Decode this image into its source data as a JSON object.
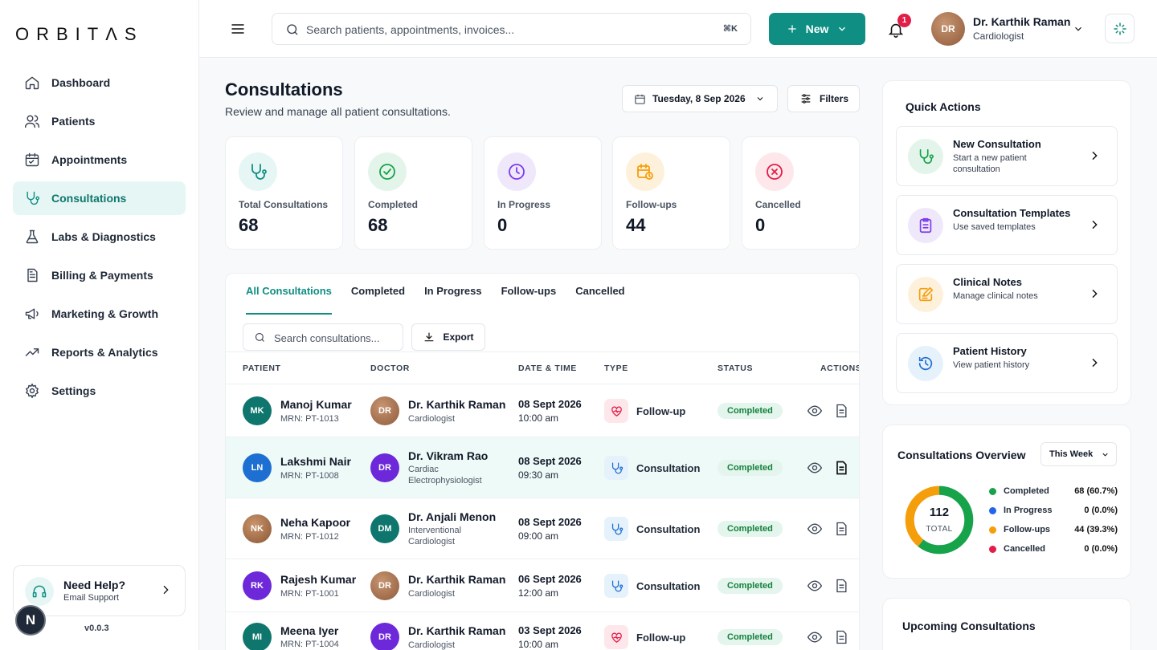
{
  "app": {
    "logo": "ORBITΛS",
    "version": "v0.0.3",
    "bottom_badge": "N"
  },
  "nav": [
    {
      "label": "Dashboard",
      "icon": "home-icon"
    },
    {
      "label": "Patients",
      "icon": "users-icon"
    },
    {
      "label": "Appointments",
      "icon": "calendar-icon"
    },
    {
      "label": "Consultations",
      "icon": "stethoscope-icon",
      "active": true
    },
    {
      "label": "Labs & Diagnostics",
      "icon": "flask-icon"
    },
    {
      "label": "Billing & Payments",
      "icon": "receipt-icon"
    },
    {
      "label": "Marketing & Growth",
      "icon": "megaphone-icon"
    },
    {
      "label": "Reports & Analytics",
      "icon": "trend-icon"
    },
    {
      "label": "Settings",
      "icon": "gear-icon"
    }
  ],
  "help": {
    "title": "Need Help?",
    "subtitle": "Email Support"
  },
  "header": {
    "search_placeholder": "Search patients, appointments, invoices...",
    "shortcut": "⌘K",
    "new_label": "New",
    "notifications": "1",
    "user": {
      "initials": "DR",
      "name": "Dr. Karthik Raman",
      "role": "Cardiologist"
    }
  },
  "page": {
    "title": "Consultations",
    "subtitle": "Review and manage all patient consultations.",
    "date": "Tuesday, 8 Sep 2026",
    "filters_label": "Filters"
  },
  "stats": [
    {
      "label": "Total Consultations",
      "value": "68",
      "color": "#0f8f83"
    },
    {
      "label": "Completed",
      "value": "68",
      "color": "#16a34a"
    },
    {
      "label": "In Progress",
      "value": "0",
      "color": "#7c3aed"
    },
    {
      "label": "Follow-ups",
      "value": "44",
      "color": "#f59e0b"
    },
    {
      "label": "Cancelled",
      "value": "0",
      "color": "#e11d48"
    }
  ],
  "table": {
    "tabs": [
      "All Consultations",
      "Completed",
      "In Progress",
      "Follow-ups",
      "Cancelled"
    ],
    "search_placeholder": "Search consultations...",
    "export_label": "Export",
    "headers": [
      "PATIENT",
      "DOCTOR",
      "DATE & TIME",
      "TYPE",
      "STATUS",
      "ACTIONS"
    ],
    "rows": [
      {
        "initials": "MK",
        "patient": "Manoj Kumar",
        "mrn": "MRN: PT-1013",
        "doc_initials": "DR",
        "doctor": "Dr. Karthik Raman",
        "specialty": "Cardiologist",
        "date": "08 Sept 2026",
        "time": "10:00 am",
        "type": "Follow-up",
        "status": "Completed"
      },
      {
        "initials": "LN",
        "patient": "Lakshmi Nair",
        "mrn": "MRN: PT-1008",
        "doc_initials": "DR",
        "doctor": "Dr. Vikram Rao",
        "specialty": "Cardiac Electrophysiologist",
        "date": "08 Sept 2026",
        "time": "09:30 am",
        "type": "Consultation",
        "status": "Completed"
      },
      {
        "initials": "NK",
        "patient": "Neha Kapoor",
        "mrn": "MRN: PT-1012",
        "doc_initials": "DM",
        "doctor": "Dr. Anjali Menon",
        "specialty": "Interventional Cardiologist",
        "date": "08 Sept 2026",
        "time": "09:00 am",
        "type": "Consultation",
        "status": "Completed"
      },
      {
        "initials": "RK",
        "patient": "Rajesh Kumar",
        "mrn": "MRN: PT-1001",
        "doc_initials": "DR",
        "doctor": "Dr. Karthik Raman",
        "specialty": "Cardiologist",
        "date": "06 Sept 2026",
        "time": "12:00 am",
        "type": "Consultation",
        "status": "Completed"
      },
      {
        "initials": "MI",
        "patient": "Meena Iyer",
        "mrn": "MRN: PT-1004",
        "doc_initials": "DR",
        "doctor": "Dr. Karthik Raman",
        "specialty": "Cardiologist",
        "date": "03 Sept 2026",
        "time": "10:00 am",
        "type": "Follow-up",
        "status": "Completed"
      }
    ]
  },
  "quick_actions": {
    "title": "Quick Actions",
    "items": [
      {
        "name": "New Consultation",
        "sub": "Start a new patient consultation"
      },
      {
        "name": "Consultation Templates",
        "sub": "Use saved templates"
      },
      {
        "name": "Clinical Notes",
        "sub": "Manage clinical notes"
      },
      {
        "name": "Patient History",
        "sub": "View patient history"
      }
    ]
  },
  "overview": {
    "title": "Consultations Overview",
    "range": "This Week",
    "total": "112",
    "total_label": "TOTAL",
    "legend": [
      {
        "name": "Completed",
        "value": "68 (60.7%)",
        "pct": 60.7,
        "color": "#16a34a"
      },
      {
        "name": "In Progress",
        "value": "0 (0.0%)",
        "pct": 0,
        "color": "#2563eb"
      },
      {
        "name": "Follow-ups",
        "value": "44 (39.3%)",
        "pct": 39.3,
        "color": "#f59e0b"
      },
      {
        "name": "Cancelled",
        "value": "0 (0.0%)",
        "pct": 0,
        "color": "#e11d48"
      }
    ]
  },
  "upcoming": {
    "title": "Upcoming Consultations"
  }
}
